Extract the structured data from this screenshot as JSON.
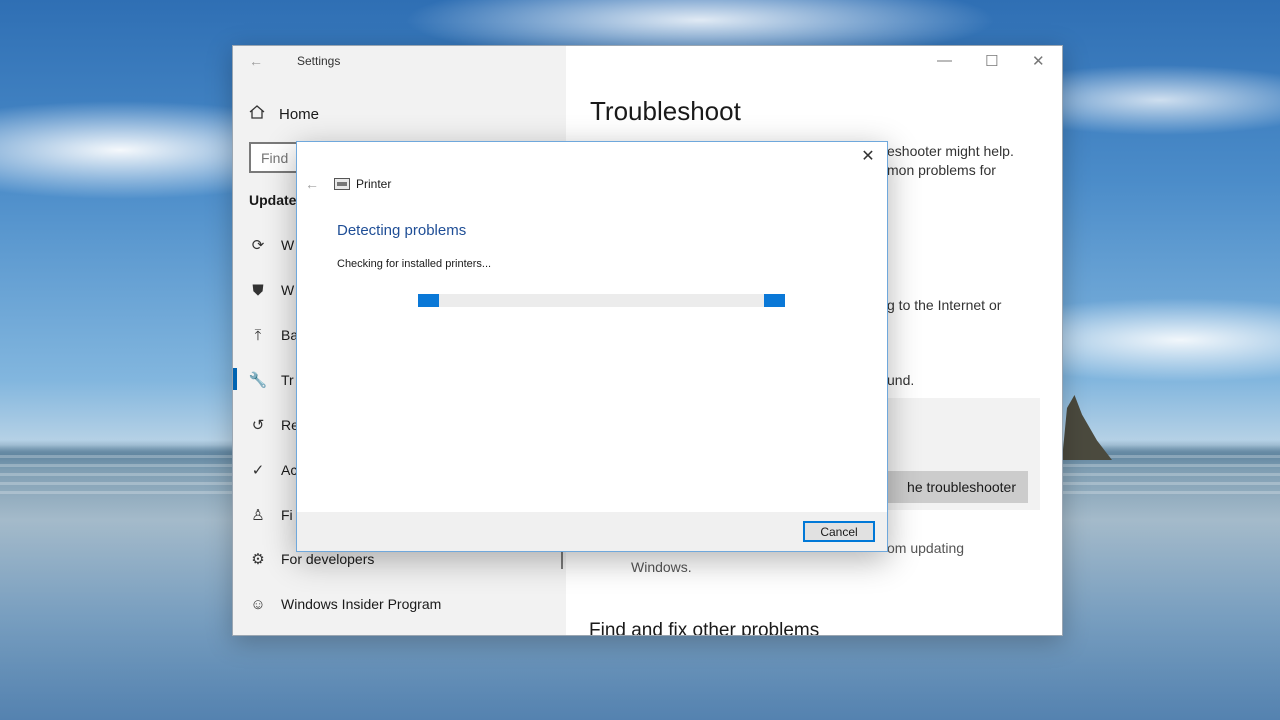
{
  "settings_window": {
    "title": "Settings",
    "back_icon": "arrow-left-icon",
    "controls": {
      "minimize": "—",
      "maximize": "☐",
      "close": "✕"
    }
  },
  "sidebar": {
    "home_label": "Home",
    "search_placeholder": "Find",
    "section_title": "Update",
    "items": [
      {
        "icon": "sync-icon",
        "label": "W",
        "glyph": "⟳"
      },
      {
        "icon": "shield-icon",
        "label": "W",
        "glyph": "⛊"
      },
      {
        "icon": "upload-arrow-icon",
        "label": "Ba",
        "glyph": "⤒"
      },
      {
        "icon": "wrench-icon",
        "label": "Tr",
        "glyph": "🔧"
      },
      {
        "icon": "history-icon",
        "label": "Re",
        "glyph": "↺"
      },
      {
        "icon": "check-circle-icon",
        "label": "Ac",
        "glyph": "✓"
      },
      {
        "icon": "person-icon",
        "label": "Fi",
        "glyph": "♙"
      },
      {
        "icon": "developer-tools-icon",
        "label": "For developers",
        "glyph": "⚙"
      },
      {
        "icon": "insider-cat-icon",
        "label": "Windows Insider Program",
        "glyph": "☺"
      }
    ]
  },
  "main": {
    "title": "Troubleshoot",
    "text_line_1": "eshooter might help.",
    "text_line_2": "mon problems for",
    "text_line_3": "g to the Internet or",
    "text_line_4": "und.",
    "run_button_label": "he troubleshooter",
    "sub_line_1": "om updating",
    "sub_line_2": "Windows.",
    "section_title": "Find and fix other problems"
  },
  "dialog": {
    "title": "Printer",
    "heading": "Detecting problems",
    "status": "Checking for installed printers...",
    "cancel_label": "Cancel",
    "close_glyph": "✕",
    "back_glyph": "←"
  }
}
